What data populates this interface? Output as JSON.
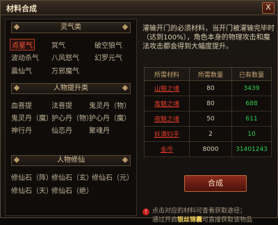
{
  "window": {
    "title": "材料合成",
    "close_label": "X"
  },
  "left": {
    "sections": [
      {
        "title": "灵气类",
        "items": [
          "点星气",
          "冥气",
          "破空狼气",
          "波动杀气",
          "八风怒气",
          "幻罗元气",
          "震仙气",
          "万邪魔气"
        ],
        "selected_index": 0
      },
      {
        "title": "人物提升类",
        "items": [
          "血菩提",
          "法菩提",
          "鬼灵丹（物）",
          "鬼灵丹（魔）",
          "护心丹（物）",
          "护心丹（魔）",
          "神行丹",
          "仙恋丹",
          "聚魂丹"
        ]
      },
      {
        "title": "人物修仙",
        "items": [
          "修仙石（阵）",
          "修仙石（玄）",
          "修仙石（元）",
          "修仙石（天）",
          "修仙石（绝）"
        ]
      }
    ]
  },
  "right": {
    "description": "灌输开门的必须材料，当开门被灌输完毕时（达到100%），角色本身的物理攻击和魔法攻击都会得到大幅度提升。",
    "table": {
      "headers": [
        "所需材料",
        "所需数量",
        "已有数量"
      ],
      "rows": [
        {
          "name": "山魈之魂",
          "required": "80",
          "owned": "3439"
        },
        {
          "name": "毒魅之魂",
          "required": "80",
          "owned": "688"
        },
        {
          "name": "夜魈之魂",
          "required": "50",
          "owned": "611"
        },
        {
          "name": "妖满妇手",
          "required": "2",
          "owned": "10"
        },
        {
          "name": "金币",
          "required": "8000",
          "owned": "31401243"
        }
      ]
    },
    "button_label": "合成",
    "hint_line1": "点击对应的材料可查看获取途径；",
    "hint_prefix": "通过开启",
    "hint_shop": "银丝锦囊",
    "hint_suffix": "可直接获取该物品"
  }
}
